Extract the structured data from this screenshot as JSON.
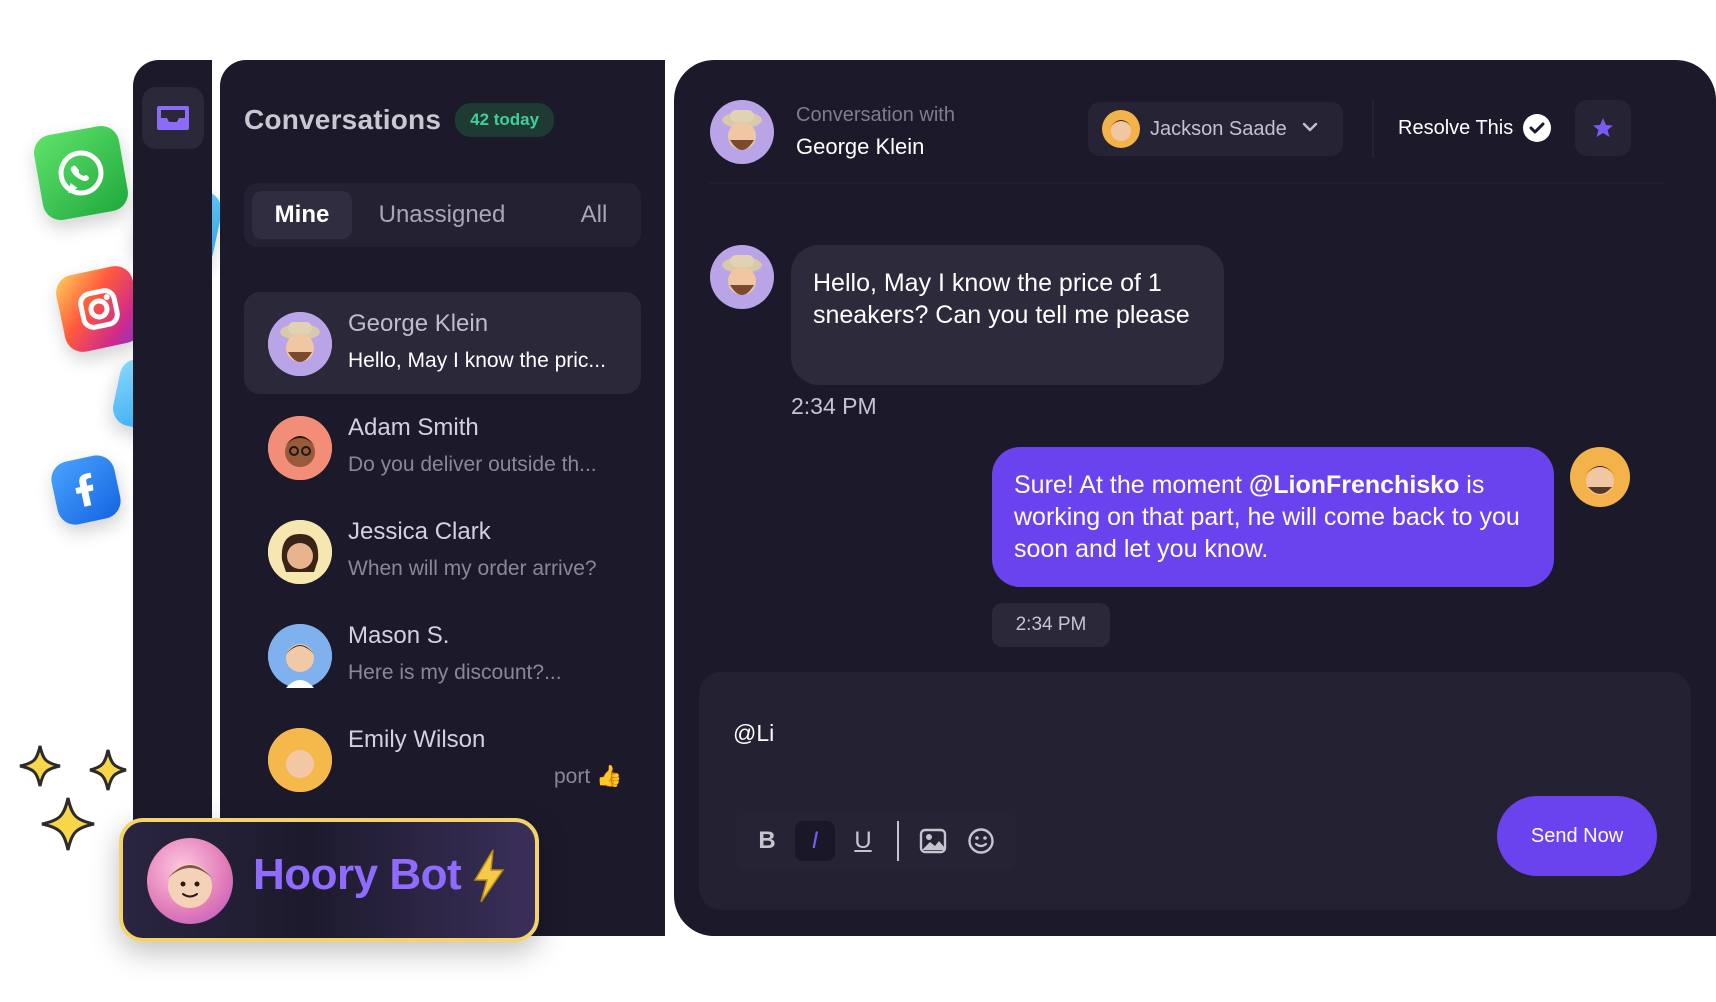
{
  "conversations": {
    "title": "Conversations",
    "badge": "42 today",
    "tabs": [
      "Mine",
      "Unassigned",
      "All"
    ],
    "items": [
      {
        "name": "George Klein",
        "snippet": "Hello, May I know the pric...",
        "avatar_color": "#b9a4e8",
        "active": true
      },
      {
        "name": "Adam Smith",
        "snippet": "Do you deliver outside th...",
        "avatar_color": "#f28d78"
      },
      {
        "name": "Jessica Clark",
        "snippet": "When will my order arrive?",
        "avatar_color": "#f6e7b0"
      },
      {
        "name": "Mason S.",
        "snippet": "Here is my discount?...",
        "avatar_color": "#7fb1ef"
      },
      {
        "name": "Emily Wilson",
        "snippet": "port 👍",
        "avatar_color": "#f5b84a"
      }
    ]
  },
  "chat": {
    "conversation_with": "Conversation with",
    "contact_name": "George Klein",
    "assignee": "Jackson Saade",
    "resolve_label": "Resolve This",
    "messages": [
      {
        "direction": "incoming",
        "text": "Hello, May I know the price of 1 sneakers? Can you tell me please",
        "time": "2:34 PM"
      },
      {
        "direction": "outgoing",
        "text_before": "Sure! At the moment ",
        "mention": "@LionFrenchisko",
        "text_after": " is working on that part, he will come back to you soon and let you know.",
        "time": "2:34 PM"
      }
    ],
    "composer_text": "@Li",
    "toolbar": {
      "bold": "B",
      "italic": "I",
      "underline": "U"
    },
    "send_label": "Send Now"
  },
  "bot": {
    "name": "Hoory Bot"
  },
  "colors": {
    "accent": "#6a43ef",
    "panel": "#1c1a2a",
    "badge_green": "#3ed09a",
    "bot_border": "#f3d36a"
  },
  "icons": [
    "inbox-icon",
    "whatsapp-icon",
    "telegram-icon",
    "instagram-icon",
    "twitter-icon",
    "facebook-icon",
    "sparkle-icon",
    "chevron-down-icon",
    "check-icon",
    "star-icon",
    "image-icon",
    "emoji-icon",
    "lightning-icon"
  ]
}
